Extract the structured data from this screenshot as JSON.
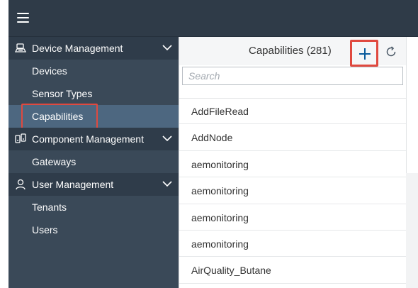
{
  "topbar": {
    "menu_icon": "hamburger-menu-icon"
  },
  "sidebar": {
    "groups": [
      {
        "label": "Device Management",
        "icon": "device-management-icon",
        "expand_icon": "chevron-down-icon",
        "items": [
          {
            "label": "Devices"
          },
          {
            "label": "Sensor Types"
          },
          {
            "label": "Capabilities",
            "active": true
          }
        ]
      },
      {
        "label": "Component Management",
        "icon": "component-management-icon",
        "expand_icon": "chevron-down-icon",
        "items": [
          {
            "label": "Gateways"
          }
        ]
      },
      {
        "label": "User Management",
        "icon": "user-icon",
        "expand_icon": "chevron-down-icon",
        "items": [
          {
            "label": "Tenants"
          },
          {
            "label": "Users"
          }
        ]
      }
    ]
  },
  "list": {
    "title": "Capabilities (281)",
    "search_placeholder": "Search",
    "search_value": "",
    "add_icon": "plus-icon",
    "refresh_icon": "refresh-icon",
    "items": [
      "AddFileRead",
      "AddNode",
      "aemonitoring",
      "aemonitoring",
      "aemonitoring",
      "aemonitoring",
      "AirQuality_Butane"
    ]
  },
  "colors": {
    "topbar": "#2f3b48",
    "sidebar": "#3a4958",
    "group_header": "#2f3c4a",
    "active_item": "#4d6780",
    "highlight": "#e0493f",
    "accent": "#0a6ed1"
  }
}
